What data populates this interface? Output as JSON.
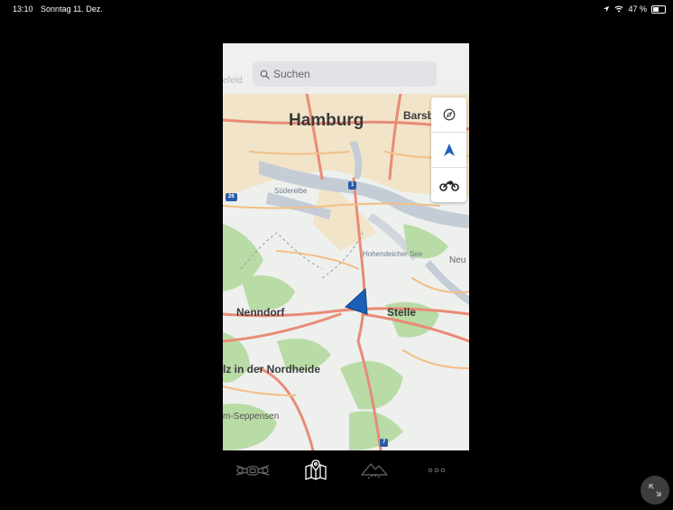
{
  "statusbar": {
    "time": "13:10",
    "date": "Sonntag 11. Dez.",
    "battery": "47 %"
  },
  "search": {
    "placeholder": "Suchen"
  },
  "map": {
    "labels": {
      "hamburg": "Hamburg",
      "barsb": "Barsb",
      "suderelbe": "Süderelbe",
      "hohendeicher": "Hohendeicher See",
      "neu": "Neu",
      "nenndorf": "Nenndorf",
      "stelle": "Stelle",
      "nordheide": "lz in der Nordheide",
      "seppensen": "m-Seppensen",
      "efeld": "efeld"
    },
    "shields": {
      "a26": "26",
      "a1": "1",
      "a7": "7"
    }
  },
  "toolbar": {
    "icons": [
      "compass-icon",
      "navigation-arrow-icon",
      "motorcycle-icon"
    ]
  },
  "bottom_nav": {
    "icons": [
      "motorcycle-front-icon",
      "map-icon",
      "mountain-icon",
      "more-icon"
    ]
  },
  "colors": {
    "background": "#000000",
    "map_land": "#eef0ee",
    "water": "#c4ccd6",
    "forest": "#b9dba6",
    "urban": "#f1e4c8",
    "road_major": "#e98b76",
    "road_minor": "#f2bf86",
    "position_arrow": "#1c5fb8"
  }
}
